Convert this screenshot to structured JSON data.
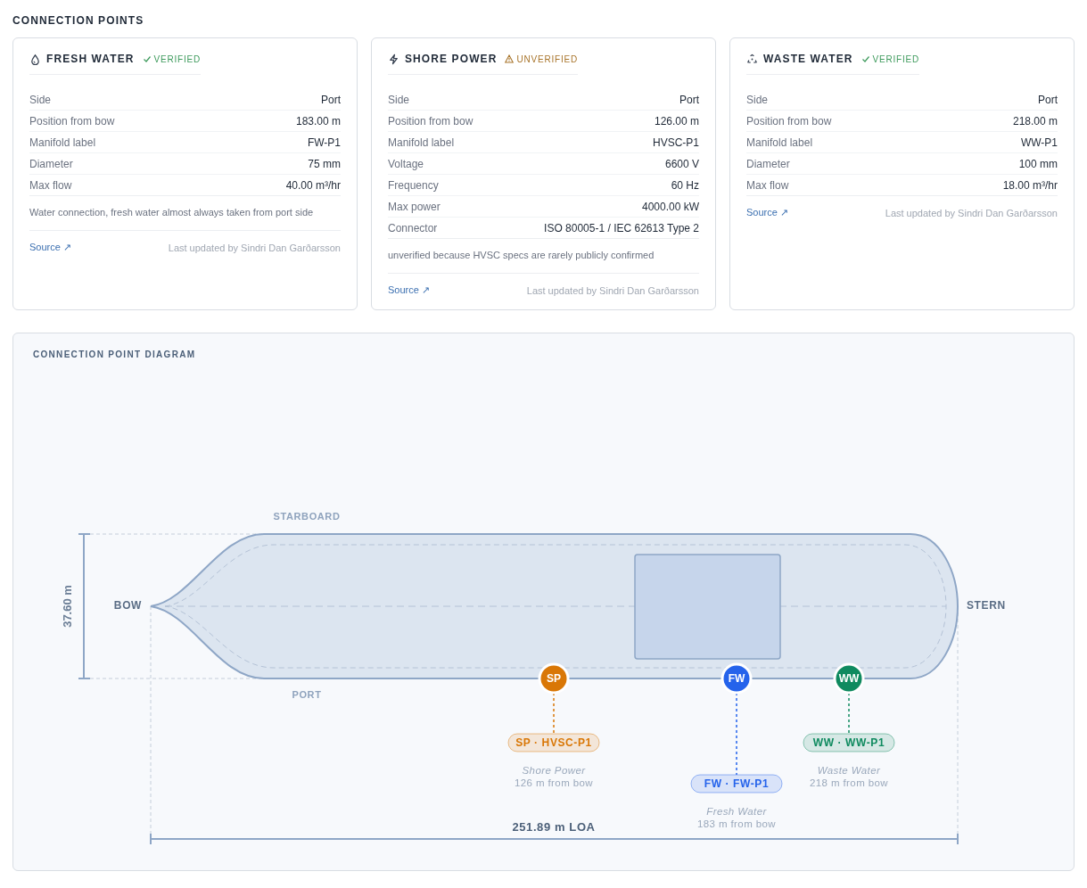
{
  "title": "CONNECTION POINTS",
  "cards": [
    {
      "kind": "water",
      "name": "FRESH WATER",
      "verified": true,
      "status": "VERIFIED",
      "rows": [
        {
          "label": "Side",
          "value": "Port"
        },
        {
          "label": "Position from bow",
          "value": "183.00 m"
        },
        {
          "label": "Manifold label",
          "value": "FW-P1"
        },
        {
          "label": "Diameter",
          "value": "75 mm"
        },
        {
          "label": "Max flow",
          "value": "40.00 m³/hr"
        }
      ],
      "note": "Water connection, fresh water almost always taken from port side",
      "source": "Source ↗",
      "updated": "Last updated by Sindri Dan Garðarsson"
    },
    {
      "kind": "power",
      "name": "SHORE POWER",
      "verified": false,
      "status": "UNVERIFIED",
      "rows": [
        {
          "label": "Side",
          "value": "Port"
        },
        {
          "label": "Position from bow",
          "value": "126.00 m"
        },
        {
          "label": "Manifold label",
          "value": "HVSC-P1"
        },
        {
          "label": "Voltage",
          "value": "6600 V"
        },
        {
          "label": "Frequency",
          "value": "60 Hz"
        },
        {
          "label": "Max power",
          "value": "4000.00 kW"
        },
        {
          "label": "Connector",
          "value": "ISO 80005-1 / IEC 62613 Type 2"
        }
      ],
      "note": "unverified because HVSC specs are rarely publicly confirmed",
      "source": "Source ↗",
      "updated": "Last updated by Sindri Dan Garðarsson"
    },
    {
      "kind": "waste",
      "name": "WASTE WATER",
      "verified": true,
      "status": "VERIFIED",
      "rows": [
        {
          "label": "Side",
          "value": "Port"
        },
        {
          "label": "Position from bow",
          "value": "218.00 m"
        },
        {
          "label": "Manifold label",
          "value": "WW-P1"
        },
        {
          "label": "Diameter",
          "value": "100 mm"
        },
        {
          "label": "Max flow",
          "value": "18.00 m³/hr"
        }
      ],
      "source": "Source ↗",
      "updated": "Last updated by Sindri Dan Garðarsson"
    }
  ],
  "diagram": {
    "title": "CONNECTION POINT DIAGRAM",
    "starboard": "STARBOARD",
    "port": "PORT",
    "bow": "BOW",
    "stern": "STERN",
    "beam": "37.60 m",
    "loa": "251.89 m LOA",
    "markers": [
      {
        "code": "SP",
        "label": "SP · HVSC-P1",
        "name": "Shore Power",
        "distance": "126 m from bow",
        "color": "#d97706"
      },
      {
        "code": "FW",
        "label": "FW · FW-P1",
        "name": "Fresh Water",
        "distance": "183 m from bow",
        "color": "#2563eb"
      },
      {
        "code": "WW",
        "label": "WW · WW-P1",
        "name": "Waste Water",
        "distance": "218 m from bow",
        "color": "#0f8a5f"
      }
    ]
  }
}
